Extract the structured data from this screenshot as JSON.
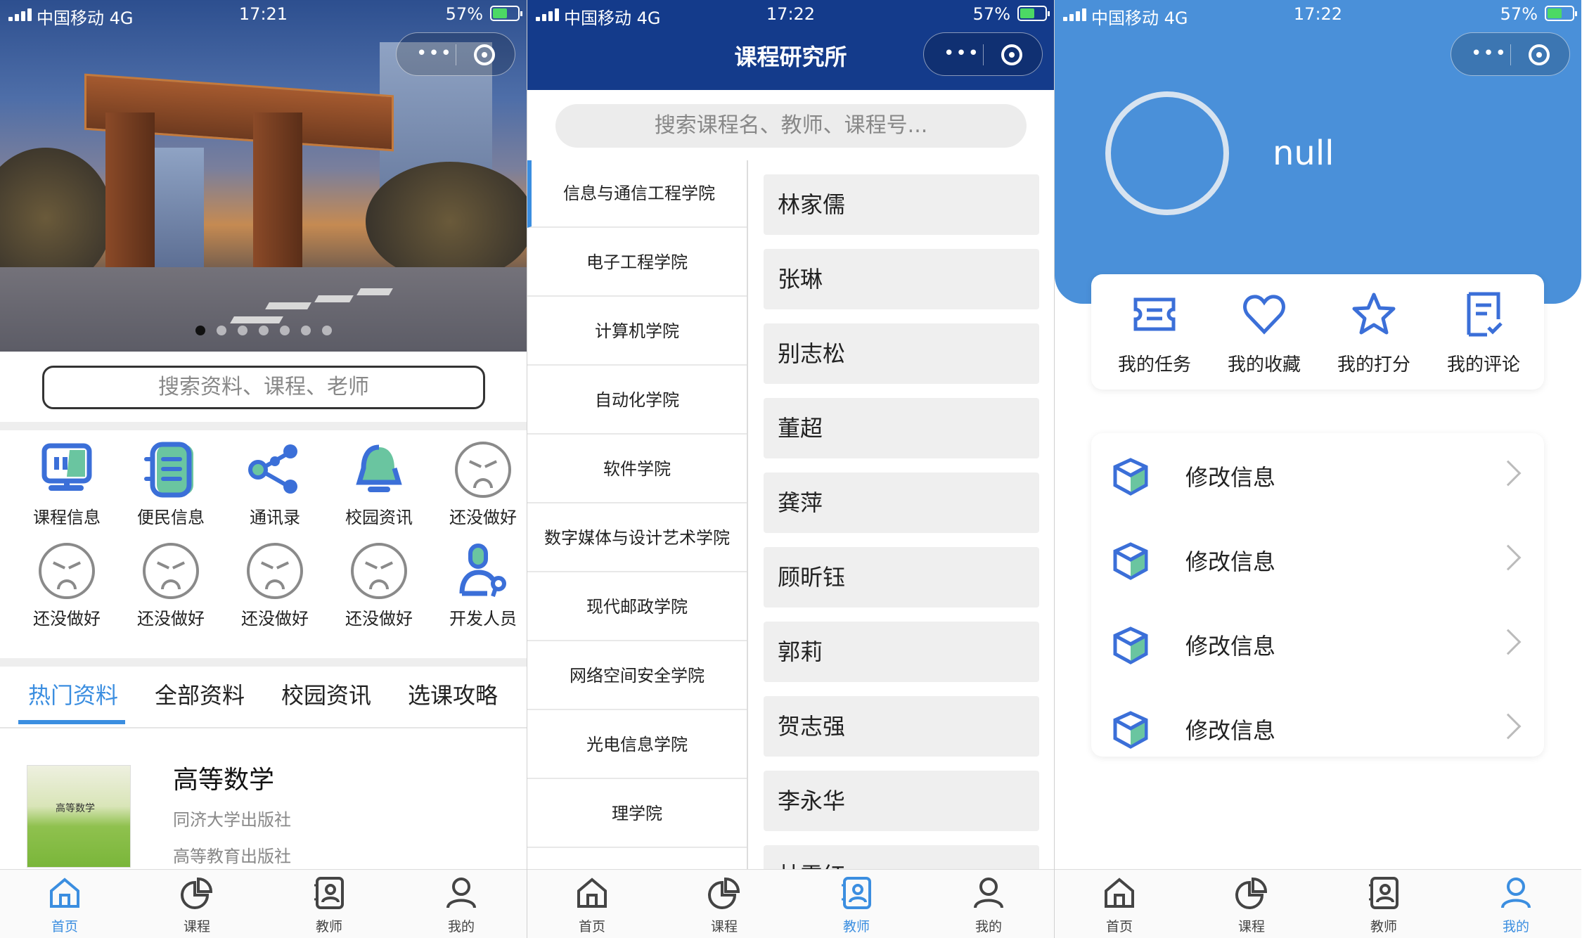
{
  "status": [
    {
      "carrier": "中国移动  4G",
      "time": "17:21",
      "battery": "57%"
    },
    {
      "carrier": "中国移动  4G",
      "time": "17:22",
      "battery": "57%"
    },
    {
      "carrier": "中国移动  4G",
      "time": "17:22",
      "battery": "57%"
    }
  ],
  "home": {
    "search_placeholder": "搜索资料、课程、老师",
    "banner_dots": 7,
    "grid": [
      {
        "label": "课程信息",
        "icon": "course-info-icon"
      },
      {
        "label": "便民信息",
        "icon": "convenience-info-icon"
      },
      {
        "label": "通讯录",
        "icon": "share-contacts-icon"
      },
      {
        "label": "校园资讯",
        "icon": "bell-news-icon"
      },
      {
        "label": "还没做好",
        "icon": "sad-face-icon"
      },
      {
        "label": "还没做好",
        "icon": "sad-face-icon"
      },
      {
        "label": "还没做好",
        "icon": "sad-face-icon"
      },
      {
        "label": "还没做好",
        "icon": "sad-face-icon"
      },
      {
        "label": "还没做好",
        "icon": "sad-face-icon"
      },
      {
        "label": "开发人员",
        "icon": "developer-icon"
      }
    ],
    "tabs": [
      "热门资料",
      "全部资料",
      "校园资讯",
      "选课攻略"
    ],
    "item": {
      "title": "高等数学",
      "sub1": "同济大学出版社",
      "sub2": "高等教育出版社",
      "cover_text": "高等数学"
    }
  },
  "courses": {
    "title": "课程研究所",
    "search_placeholder": "搜索课程名、教师、课程号...",
    "categories": [
      "信息与通信工程学院",
      "电子工程学院",
      "计算机学院",
      "自动化学院",
      "软件学院",
      "数字媒体与设计艺术学院",
      "现代邮政学院",
      "网络空间安全学院",
      "光电信息学院",
      "理学院"
    ],
    "teachers": [
      "林家儒",
      "张琳",
      "别志松",
      "董超",
      "龚萍",
      "顾昕钰",
      "郭莉",
      "贺志强",
      "李永华",
      "林雪红"
    ]
  },
  "mine": {
    "username": "null",
    "quick": [
      "我的任务",
      "我的收藏",
      "我的打分",
      "我的评论"
    ],
    "list": [
      "修改信息",
      "修改信息",
      "修改信息",
      "修改信息"
    ]
  },
  "tabbar": [
    "首页",
    "课程",
    "教师",
    "我的"
  ],
  "colors": {
    "accent": "#3b8ee0",
    "nav_blue": "#143b8b",
    "header_blue": "#4a90d9",
    "teal": "#6ac5a0"
  }
}
